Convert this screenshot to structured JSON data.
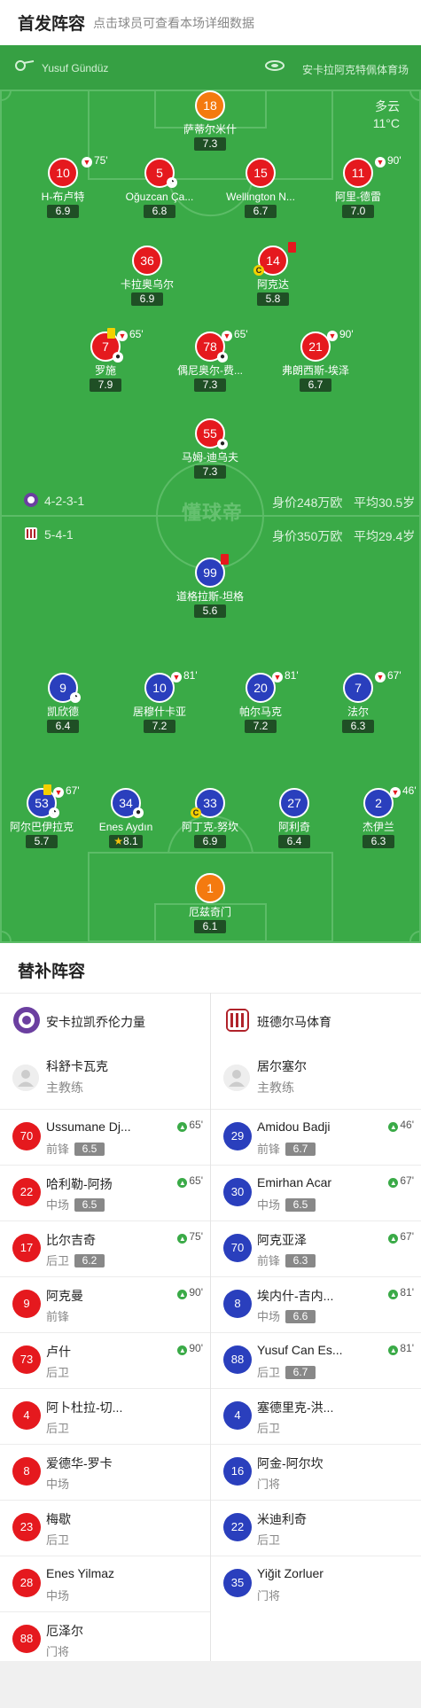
{
  "header": {
    "title": "首发阵容",
    "subtitle": "点击球员可查看本场详细数据"
  },
  "pitch": {
    "home_coach": "Yusuf Gündüz",
    "venue": "安卡拉阿克特佩体育场",
    "weather": {
      "condition": "多云",
      "temp": "11°C"
    },
    "watermark": "懂球帝",
    "home_formation": "4-2-3-1",
    "home_value": "身价248万欧",
    "home_age": "平均30.5岁",
    "away_formation": "5-4-1",
    "away_value": "身价350万欧",
    "away_age": "平均29.4岁",
    "home_players": [
      {
        "number": "18",
        "name": "萨蒂尔米什",
        "rating": "7.3"
      },
      {
        "number": "10",
        "name": "H-布卢特",
        "rating": "6.9",
        "sub": "75'"
      },
      {
        "number": "5",
        "name": "Oğuzcan Ça...",
        "rating": "6.8"
      },
      {
        "number": "15",
        "name": "Wellington N...",
        "rating": "6.7"
      },
      {
        "number": "11",
        "name": "阿里-德雷",
        "rating": "7.0",
        "sub": "90'"
      },
      {
        "number": "36",
        "name": "卡拉奥乌尔",
        "rating": "6.9"
      },
      {
        "number": "14",
        "name": "阿克达",
        "rating": "5.8"
      },
      {
        "number": "7",
        "name": "罗施",
        "rating": "7.9",
        "sub": "65'"
      },
      {
        "number": "78",
        "name": "偶尼奥尔-费...",
        "rating": "7.3",
        "sub": "65'"
      },
      {
        "number": "21",
        "name": "弗朗西斯-埃泽",
        "rating": "6.7",
        "sub": "90'"
      },
      {
        "number": "55",
        "name": "马姆-迪乌夫",
        "rating": "7.3"
      }
    ],
    "away_players": [
      {
        "number": "99",
        "name": "道格拉斯-坦格",
        "rating": "5.6"
      },
      {
        "number": "9",
        "name": "凯欣德",
        "rating": "6.4"
      },
      {
        "number": "10",
        "name": "居穆什卡亚",
        "rating": "7.2",
        "sub": "81'"
      },
      {
        "number": "20",
        "name": "帕尔马克",
        "rating": "7.2",
        "sub": "81'"
      },
      {
        "number": "7",
        "name": "法尔",
        "rating": "6.3",
        "sub": "67'"
      },
      {
        "number": "53",
        "name": "阿尔巴伊拉克",
        "rating": "5.7",
        "sub": "67'"
      },
      {
        "number": "34",
        "name": "Enes Aydın",
        "rating": "8.1"
      },
      {
        "number": "33",
        "name": "阿丁克-努坎",
        "rating": "6.9"
      },
      {
        "number": "27",
        "name": "阿利奇",
        "rating": "6.4"
      },
      {
        "number": "2",
        "name": "杰伊兰",
        "rating": "6.3",
        "sub": "46'"
      },
      {
        "number": "1",
        "name": "厄兹奇门",
        "rating": "6.1"
      }
    ]
  },
  "subs": {
    "title": "替补阵容",
    "home": {
      "team": "安卡拉凯乔伦力量",
      "coach_name": "科舒卡瓦克",
      "coach_role": "主教练",
      "players": [
        {
          "number": "70",
          "name": "Ussumane Dj...",
          "pos": "前锋",
          "rating": "6.5",
          "in": "65'"
        },
        {
          "number": "22",
          "name": "哈利勒-阿扬",
          "pos": "中场",
          "rating": "6.5",
          "in": "65'"
        },
        {
          "number": "17",
          "name": "比尔吉奇",
          "pos": "后卫",
          "rating": "6.2",
          "in": "75'"
        },
        {
          "number": "9",
          "name": "阿克曼",
          "pos": "前锋",
          "rating": "",
          "in": "90'"
        },
        {
          "number": "73",
          "name": "卢什",
          "pos": "后卫",
          "rating": "",
          "in": "90'"
        },
        {
          "number": "4",
          "name": "阿卜杜拉-切...",
          "pos": "后卫",
          "rating": "",
          "in": ""
        },
        {
          "number": "8",
          "name": "爱德华-罗卡",
          "pos": "中场",
          "rating": "",
          "in": ""
        },
        {
          "number": "23",
          "name": "梅歇",
          "pos": "后卫",
          "rating": "",
          "in": ""
        },
        {
          "number": "28",
          "name": "Enes Yilmaz",
          "pos": "中场",
          "rating": "",
          "in": ""
        },
        {
          "number": "88",
          "name": "厄泽尔",
          "pos": "门将",
          "rating": "",
          "in": ""
        }
      ]
    },
    "away": {
      "team": "班德尔马体育",
      "coach_name": "居尔塞尔",
      "coach_role": "主教练",
      "players": [
        {
          "number": "29",
          "name": "Amidou Badji",
          "pos": "前锋",
          "rating": "6.7",
          "in": "46'"
        },
        {
          "number": "30",
          "name": "Emirhan Acar",
          "pos": "中场",
          "rating": "6.5",
          "in": "67'"
        },
        {
          "number": "70",
          "name": "阿克亚泽",
          "pos": "前锋",
          "rating": "6.3",
          "in": "67'"
        },
        {
          "number": "8",
          "name": "埃内什-吉内...",
          "pos": "中场",
          "rating": "6.6",
          "in": "81'"
        },
        {
          "number": "88",
          "name": "Yusuf Can Es...",
          "pos": "后卫",
          "rating": "6.7",
          "in": "81'"
        },
        {
          "number": "4",
          "name": "塞德里克-洪...",
          "pos": "后卫",
          "rating": "",
          "in": ""
        },
        {
          "number": "16",
          "name": "阿金-阿尔坎",
          "pos": "门将",
          "rating": "",
          "in": ""
        },
        {
          "number": "22",
          "name": "米迪利奇",
          "pos": "后卫",
          "rating": "",
          "in": ""
        },
        {
          "number": "35",
          "name": "Yiğit Zorluer",
          "pos": "门将",
          "rating": "",
          "in": ""
        }
      ]
    }
  },
  "colors": {
    "pitch": "#3aaa47",
    "home": "#e5191e",
    "away": "#2a3fbd",
    "goalkeeper": "#f47a0f"
  }
}
